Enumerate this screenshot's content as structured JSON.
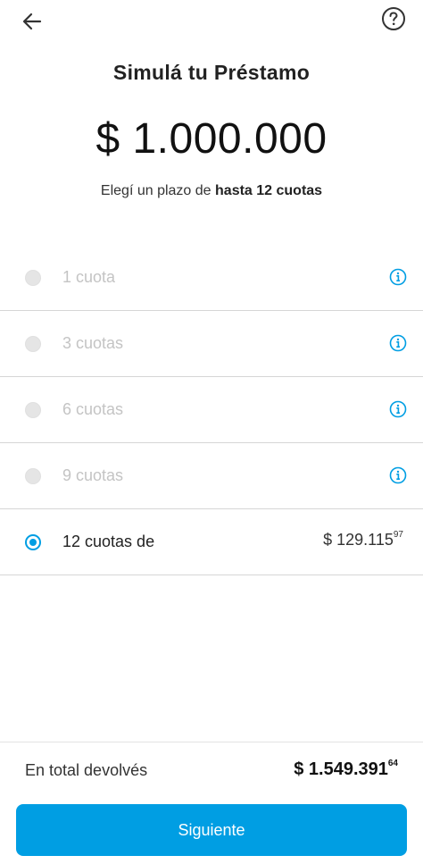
{
  "header": {
    "back_icon": "arrow-left-icon",
    "help_icon": "question-circle-icon"
  },
  "title": "Simulá tu Préstamo",
  "amount": "$ 1.000.000",
  "subtitle": {
    "prefix": "Elegí un plazo de ",
    "bold": "hasta 12 cuotas"
  },
  "options": [
    {
      "label": "1 cuota",
      "selected": false,
      "icon": "info-icon"
    },
    {
      "label": "3 cuotas",
      "selected": false,
      "icon": "info-icon"
    },
    {
      "label": "6 cuotas",
      "selected": false,
      "icon": "info-icon"
    },
    {
      "label": "9 cuotas",
      "selected": false,
      "icon": "info-icon"
    },
    {
      "label": "12 cuotas de",
      "selected": true,
      "price_main": "$ 129.115",
      "price_cents": "97"
    }
  ],
  "total": {
    "label": "En total devolvés",
    "value_main": "$ 1.549.391",
    "value_cents": "64"
  },
  "next_button": "Siguiente",
  "colors": {
    "accent": "#009ee3",
    "disabled_text": "#c4c4c4",
    "divider": "#d6d6d6"
  }
}
